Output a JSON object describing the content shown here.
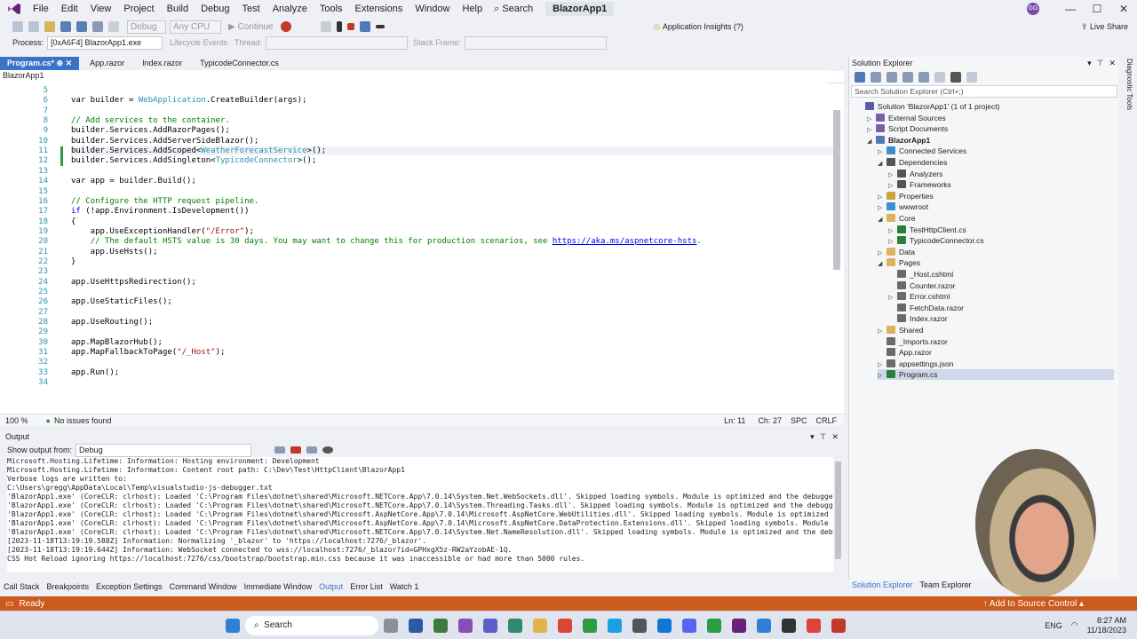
{
  "menu": [
    "File",
    "Edit",
    "View",
    "Project",
    "Build",
    "Debug",
    "Test",
    "Analyze",
    "Tools",
    "Extensions",
    "Window",
    "Help"
  ],
  "search_label": "Search",
  "window_title": "BlazorApp1",
  "user_initials": "GG",
  "toolbar": {
    "config": "Debug",
    "platform": "Any CPU",
    "continue_label": "Continue",
    "app_insights": "Application Insights (?)",
    "live_share": "Live Share"
  },
  "debug_bar": {
    "process_label": "Process:",
    "process_value": "[0xA6F4] BlazorApp1.exe",
    "lifecycle_label": "Lifecycle Events",
    "thread_label": "Thread:",
    "stackframe_label": "Stack Frame:"
  },
  "editor_tabs": [
    "Program.cs*",
    "App.razor",
    "Index.razor",
    "TypicodeConnector.cs"
  ],
  "editor_nav": "BlazorApp1",
  "code_lines": [
    {
      "n": "5",
      "html": ""
    },
    {
      "n": "6",
      "html": "var builder = <span class='ty'>WebApplication</span>.CreateBuilder(args);"
    },
    {
      "n": "7",
      "html": ""
    },
    {
      "n": "8",
      "html": "<span class='cm'>// Add services to the container.</span>"
    },
    {
      "n": "9",
      "html": "builder.Services.AddRazorPages();"
    },
    {
      "n": "10",
      "html": "builder.Services.AddServerSideBlazor();"
    },
    {
      "n": "11",
      "html": "builder.Services.AddScoped&lt;<span class='ty'>WeatherForecastService</span>&gt;();"
    },
    {
      "n": "12",
      "html": "builder.Services.AddSingleton&lt;<span class='ty'>TypicodeConnector</span>&gt;();"
    },
    {
      "n": "13",
      "html": ""
    },
    {
      "n": "14",
      "html": "var app = builder.Build();"
    },
    {
      "n": "15",
      "html": ""
    },
    {
      "n": "16",
      "html": "<span class='cm'>// Configure the HTTP request pipeline.</span>"
    },
    {
      "n": "17",
      "html": "<span class='kw'>if</span> (!app.Environment.IsDevelopment())"
    },
    {
      "n": "18",
      "html": "{"
    },
    {
      "n": "19",
      "html": "    app.UseExceptionHandler(<span class='st'>\"/Error\"</span>);"
    },
    {
      "n": "20",
      "html": "    <span class='cm'>// The default HSTS value is 30 days. You may want to change this for production scenarios, see </span><span class='lnk'>https://aka.ms/aspnetcore-hsts</span><span class='cm'>.</span>"
    },
    {
      "n": "21",
      "html": "    app.UseHsts();"
    },
    {
      "n": "22",
      "html": "}"
    },
    {
      "n": "23",
      "html": ""
    },
    {
      "n": "24",
      "html": "app.UseHttpsRedirection();"
    },
    {
      "n": "25",
      "html": ""
    },
    {
      "n": "26",
      "html": "app.UseStaticFiles();"
    },
    {
      "n": "27",
      "html": ""
    },
    {
      "n": "28",
      "html": "app.UseRouting();"
    },
    {
      "n": "29",
      "html": ""
    },
    {
      "n": "30",
      "html": "app.MapBlazorHub();"
    },
    {
      "n": "31",
      "html": "app.MapFallbackToPage(<span class='st'>\"/_Host\"</span>);"
    },
    {
      "n": "32",
      "html": ""
    },
    {
      "n": "33",
      "html": "app.Run();"
    },
    {
      "n": "34",
      "html": ""
    }
  ],
  "editor_status": {
    "zoom": "100 %",
    "issues": "No issues found",
    "ln": "Ln: 11",
    "ch": "Ch: 27",
    "ws": "SPC",
    "eol": "CRLF"
  },
  "output": {
    "title": "Output",
    "show_from_label": "Show output from:",
    "source": "Debug",
    "lines": [
      "Microsoft.Hosting.Lifetime: Information: Hosting environment: Development",
      "Microsoft.Hosting.Lifetime: Information: Content root path: C:\\Dev\\Test\\HttpClient\\BlazorApp1",
      "Verbose logs are written to:",
      "C:\\Users\\gregg\\AppData\\Local\\Temp\\visualstudio-js-debugger.txt",
      "'BlazorApp1.exe' (CoreCLR: clrhost): Loaded 'C:\\Program Files\\dotnet\\shared\\Microsoft.NETCore.App\\7.0.14\\System.Net.WebSockets.dll'. Skipped loading symbols. Module is optimized and the debugger opt",
      "'BlazorApp1.exe' (CoreCLR: clrhost): Loaded 'C:\\Program Files\\dotnet\\shared\\Microsoft.NETCore.App\\7.0.14\\System.Threading.Tasks.dll'. Skipped loading symbols. Module is optimized and the debugger op",
      "'BlazorApp1.exe' (CoreCLR: clrhost): Loaded 'C:\\Program Files\\dotnet\\shared\\Microsoft.AspNetCore.App\\7.0.14\\Microsoft.AspNetCore.WebUtilities.dll'. Skipped loading symbols. Module is optimized and t",
      "'BlazorApp1.exe' (CoreCLR: clrhost): Loaded 'C:\\Program Files\\dotnet\\shared\\Microsoft.AspNetCore.App\\7.0.14\\Microsoft.AspNetCore.DataProtection.Extensions.dll'. Skipped loading symbols. Module is opt",
      "'BlazorApp1.exe' (CoreCLR: clrhost): Loaded 'C:\\Program Files\\dotnet\\shared\\Microsoft.NETCore.App\\7.0.14\\System.Net.NameResolution.dll'. Skipped loading symbols. Module is optimized and the debugger",
      "[2023-11-18T13:19:19.588Z] Information: Normalizing '_blazor' to 'https://localhost:7276/_blazor'.",
      "[2023-11-18T13:19:19.644Z] Information: WebSocket connected to wss://localhost:7276/_blazor?id=GPHxgX5z-RW2aYzobAE-1Q.",
      "CSS Hot Reload ignoring https://localhost:7276/css/bootstrap/bootstrap.min.css because it was inaccessible or had more than 5000 rules."
    ]
  },
  "bottom_tabs": [
    "Call Stack",
    "Breakpoints",
    "Exception Settings",
    "Command Window",
    "Immediate Window",
    "Output",
    "Error List",
    "Watch 1"
  ],
  "se_bottom_tabs": [
    "Solution Explorer",
    "Team Explorer"
  ],
  "status": {
    "ready": "Ready",
    "source_control": "Add to Source Control"
  },
  "solution_explorer": {
    "title": "Solution Explorer",
    "search_placeholder": "Search Solution Explorer (Ctrl+;)",
    "nodes": [
      {
        "label": "Solution 'BlazorApp1' (1 of 1 project)",
        "indent": 0,
        "arrow": "",
        "icon": "#5a5aa8"
      },
      {
        "label": "External Sources",
        "indent": 1,
        "arrow": "▷",
        "icon": "#7b5ea7"
      },
      {
        "label": "Script Documents",
        "indent": 1,
        "arrow": "▷",
        "icon": "#7b5ea7"
      },
      {
        "label": "BlazorApp1",
        "indent": 1,
        "arrow": "◢",
        "icon": "#4f7ab5",
        "bold": true
      },
      {
        "label": "Connected Services",
        "indent": 2,
        "arrow": "▷",
        "icon": "#3c8fcf"
      },
      {
        "label": "Dependencies",
        "indent": 2,
        "arrow": "◢",
        "icon": "#555555"
      },
      {
        "label": "Analyzers",
        "indent": 3,
        "arrow": "▷",
        "icon": "#555555"
      },
      {
        "label": "Frameworks",
        "indent": 3,
        "arrow": "▷",
        "icon": "#555555"
      },
      {
        "label": "Properties",
        "indent": 2,
        "arrow": "▷",
        "icon": "#c9a43b"
      },
      {
        "label": "wwwroot",
        "indent": 2,
        "arrow": "▷",
        "icon": "#3c8fcf"
      },
      {
        "label": "Core",
        "indent": 2,
        "arrow": "◢",
        "icon": "#dcb35c"
      },
      {
        "label": "TestHttpClient.cs",
        "indent": 3,
        "arrow": "▷",
        "icon": "#2f7d3c",
        "cs": true
      },
      {
        "label": "TypicodeConnector.cs",
        "indent": 3,
        "arrow": "▷",
        "icon": "#2f7d3c",
        "cs": true
      },
      {
        "label": "Data",
        "indent": 2,
        "arrow": "▷",
        "icon": "#dcb35c"
      },
      {
        "label": "Pages",
        "indent": 2,
        "arrow": "◢",
        "icon": "#dcb35c"
      },
      {
        "label": "_Host.cshtml",
        "indent": 3,
        "arrow": "",
        "icon": "#6a6a6a"
      },
      {
        "label": "Counter.razor",
        "indent": 3,
        "arrow": "",
        "icon": "#6a6a6a"
      },
      {
        "label": "Error.cshtml",
        "indent": 3,
        "arrow": "▷",
        "icon": "#6a6a6a"
      },
      {
        "label": "FetchData.razor",
        "indent": 3,
        "arrow": "",
        "icon": "#6a6a6a"
      },
      {
        "label": "Index.razor",
        "indent": 3,
        "arrow": "",
        "icon": "#6a6a6a"
      },
      {
        "label": "Shared",
        "indent": 2,
        "arrow": "▷",
        "icon": "#dcb35c"
      },
      {
        "label": "_Imports.razor",
        "indent": 2,
        "arrow": "",
        "icon": "#6a6a6a"
      },
      {
        "label": "App.razor",
        "indent": 2,
        "arrow": "",
        "icon": "#6a6a6a"
      },
      {
        "label": "appsettings.json",
        "indent": 2,
        "arrow": "▷",
        "icon": "#6a6a6a"
      },
      {
        "label": "Program.cs",
        "indent": 2,
        "arrow": "▷",
        "icon": "#2f7d3c",
        "cs": true,
        "selected": true
      }
    ]
  },
  "side_strip": "Diagnostic Tools",
  "taskbar": {
    "search_label": "Search",
    "lang": "ENG",
    "time": "8:27 AM",
    "date": "11/18/2023"
  },
  "colors": {
    "accent": "#3a74c9",
    "status": "#cc5a1d"
  }
}
